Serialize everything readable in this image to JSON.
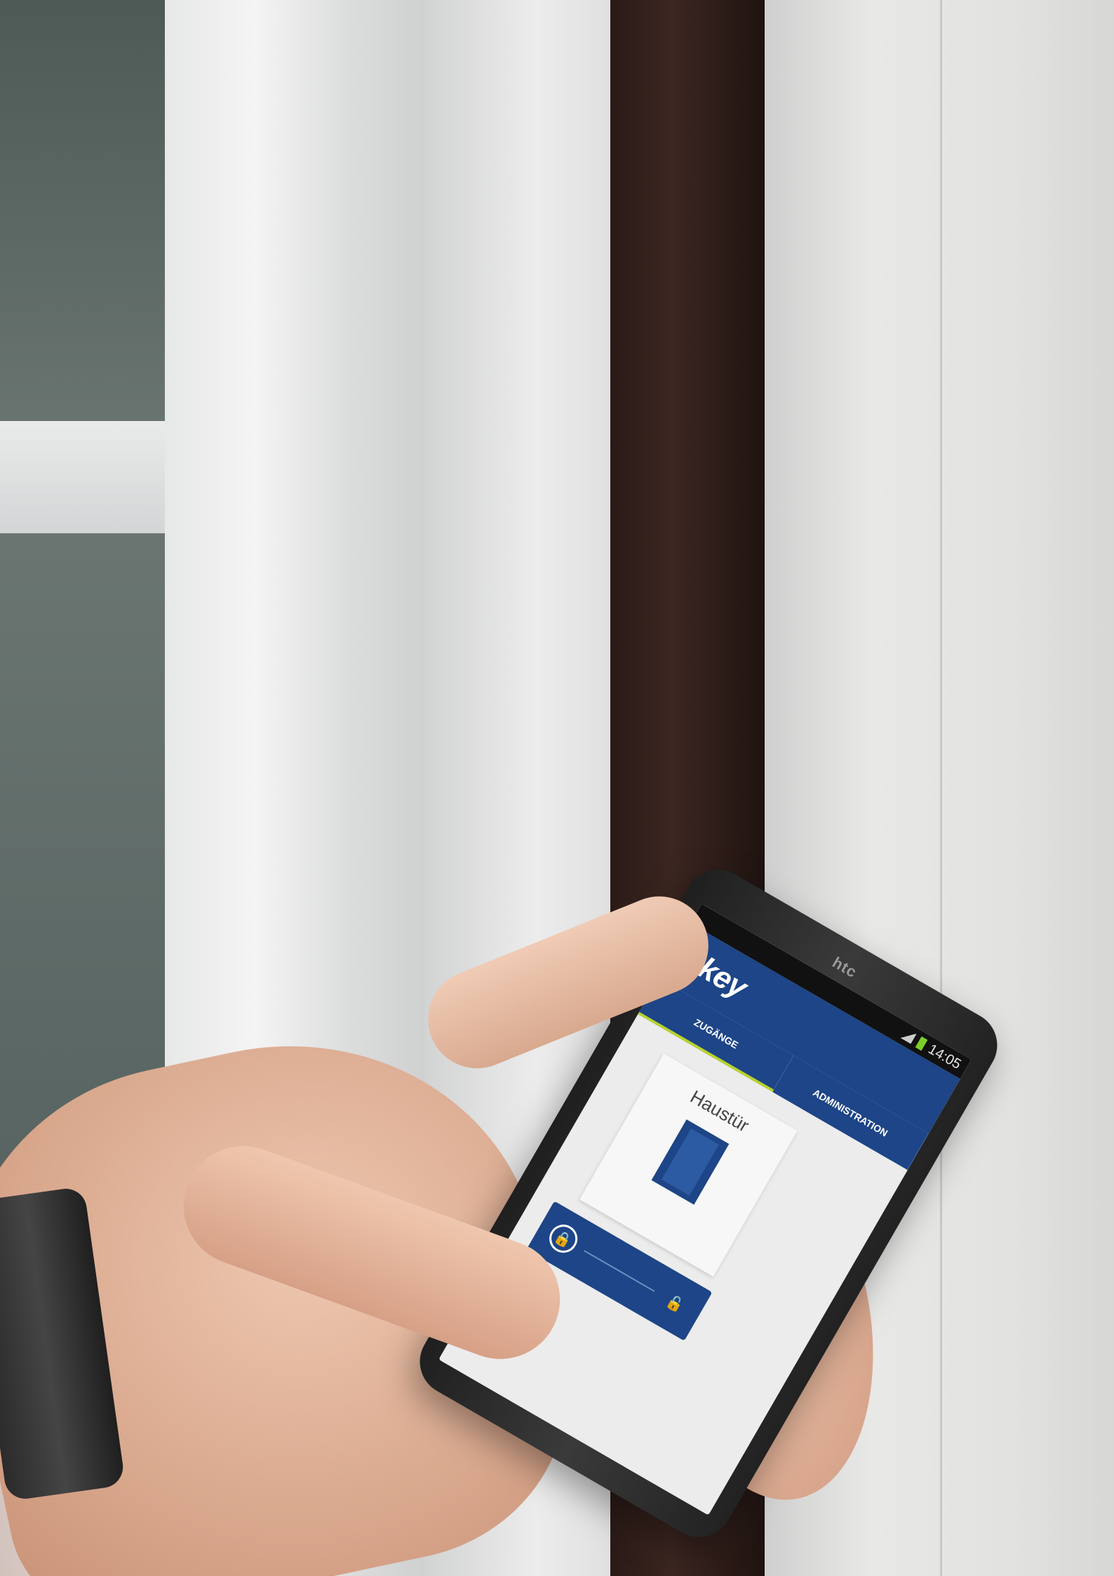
{
  "phone": {
    "brand": "htc",
    "status_bar": {
      "time": "14:05"
    },
    "app": {
      "logo": "ekey",
      "tabs": [
        {
          "label": "ZUGÄNGE",
          "active": true
        },
        {
          "label": "ADMINISTRATION",
          "active": false
        }
      ],
      "door_card": {
        "name": "Haustür",
        "icon": "door-icon"
      },
      "slider": {
        "left_icon": "lock-icon",
        "right_icon": "unlock-icon"
      }
    }
  },
  "colors": {
    "app_blue": "#1d4587",
    "accent_green": "#b7d22f"
  }
}
